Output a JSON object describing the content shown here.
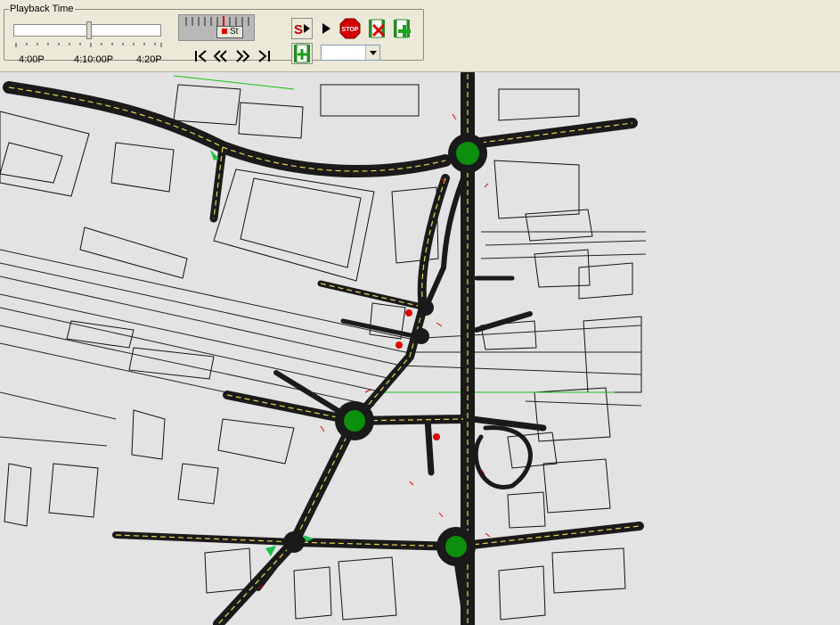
{
  "playback": {
    "legend": "Playback Time",
    "slider_level": 0.55,
    "times": [
      "4:00P",
      "4:10:00P",
      "4:20P"
    ]
  },
  "speed": {
    "label": "St"
  },
  "icons": {
    "step": "step-forward-icon",
    "play": "play-icon",
    "stop": "stop-icon",
    "stop_text": "STOP",
    "remove": "film-remove-icon",
    "add": "film-add-icon",
    "first": "skip-first-icon",
    "rewind": "rewind-icon",
    "forward": "fast-forward-icon",
    "last": "skip-last-icon",
    "grid": "film-grid-icon"
  },
  "colors": {
    "road": "#1a1a1a",
    "lane_marking": "#e6d84a",
    "roundabout": "#0c8f0c",
    "signal": "#e00000",
    "background": "#e3e3e3"
  }
}
